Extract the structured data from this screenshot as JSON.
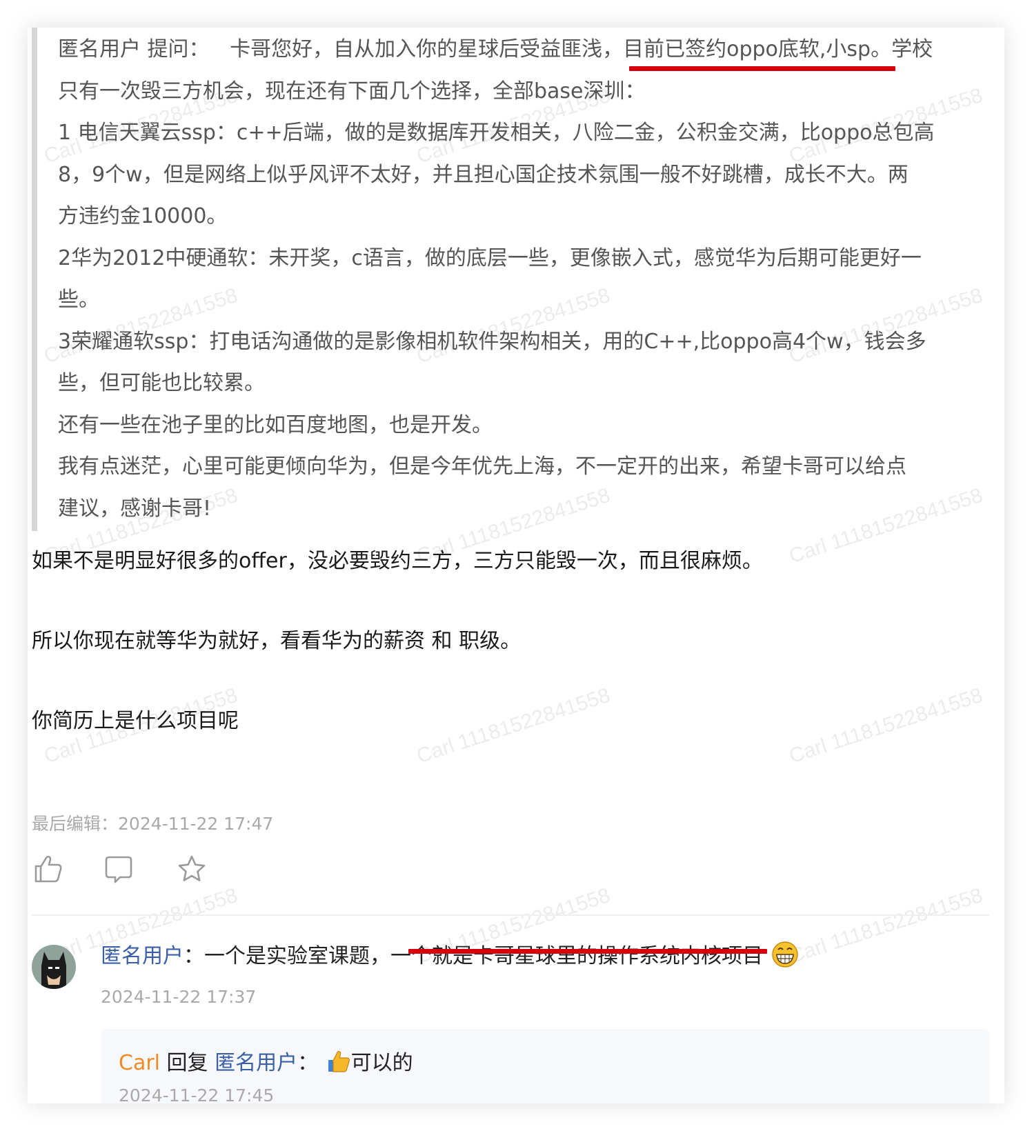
{
  "question": {
    "author": "匿名用户",
    "label": "提问：",
    "lines": [
      "卡哥您好，自从加入你的星球后受益匪浅，目前已签约oppo底软,小sp。学校",
      "只有一次毁三方机会，现在还有下面几个选择，全部base深圳：",
      "1 电信天翼云ssp：c++后端，做的是数据库开发相关，八险二金，公积金交满，比oppo总包高",
      "8，9个w，但是网络上似乎风评不太好，并且担心国企技术氛围一般不好跳槽，成长不大。两",
      "方违约金10000。",
      "2华为2012中硬通软：未开奖，c语言，做的底层一些，更像嵌入式，感觉华为后期可能更好一",
      "些。",
      "3荣耀通软ssp：打电话沟通做的是影像相机软件架构相关，用的C++,比oppo高4个w，钱会多",
      "些，但可能也比较累。",
      "还有一些在池子里的比如百度地图，也是开发。",
      "我有点迷茫，心里可能更倾向华为，但是今年优先上海，不一定开的出来，希望卡哥可以给点",
      "建议，感谢卡哥!"
    ]
  },
  "answer": {
    "paragraphs": [
      "如果不是明显好很多的offer，没必要毁约三方，三方只能毁一次，而且很麻烦。",
      "所以你现在就等华为就好，看看华为的薪资 和 职级。",
      "你简历上是什么项目呢"
    ],
    "edited_label": "最后编辑：",
    "edited_time": "2024-11-22 17:47"
  },
  "actions": [
    "thumbs-up-icon",
    "comment-icon",
    "star-icon"
  ],
  "comment": {
    "author": "匿名用户",
    "separator": "：",
    "text": "一个是实验室课题，一个就是卡哥星球里的操作系统内核项目",
    "emoji": "grin-emoji-icon",
    "time": "2024-11-22 17:37"
  },
  "reply": {
    "author": "Carl",
    "verb": "回复",
    "target": "匿名用户",
    "separator": "：",
    "emoji": "thumbs-up-emoji-icon",
    "text": "可以的",
    "time": "2024-11-22 17:45"
  },
  "watermark": "Carl 11181522841558",
  "colors": {
    "underline": "#d7000f",
    "link": "#3a5fa6",
    "reply_author": "#f08a24",
    "quote_bar": "#d6d6d6"
  }
}
